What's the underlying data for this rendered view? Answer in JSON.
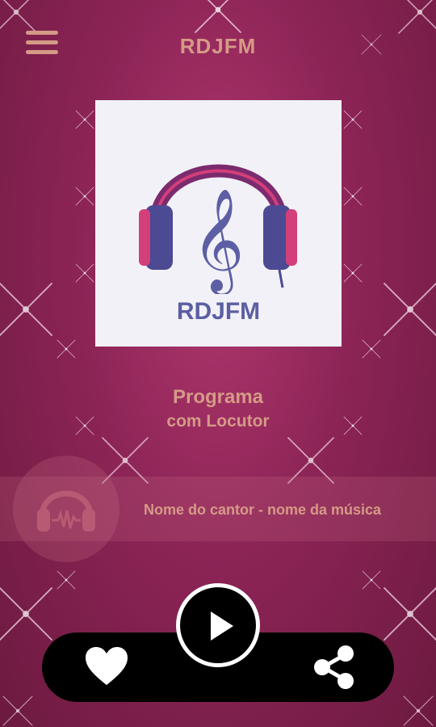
{
  "app": {
    "title": "RDJFM"
  },
  "header": {
    "menu_icon": "hamburger-menu-icon"
  },
  "cover": {
    "logo_text": "RDJFM",
    "icon": "headphones-treble-clef-icon"
  },
  "program": {
    "title": "Programa",
    "host": "com Locutor"
  },
  "now_playing": {
    "text": "Nome do cantor - nome da música",
    "icon": "headphones-icon"
  },
  "controls": {
    "favorite_icon": "heart-icon",
    "play_icon": "play-icon",
    "share_icon": "share-icon"
  },
  "colors": {
    "accent": "#d59a86",
    "background": "#8c2456",
    "bar": "#000000",
    "logo": "#5c5fa3"
  }
}
